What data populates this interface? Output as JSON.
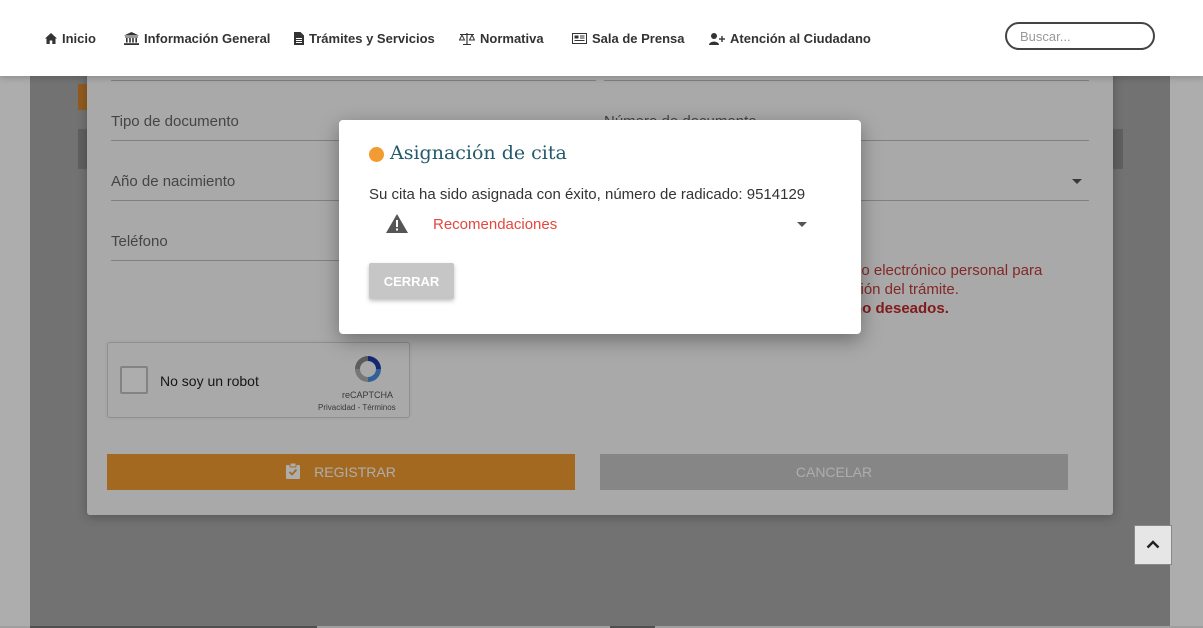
{
  "nav": {
    "items": [
      {
        "label": "Inicio",
        "icon": "home-icon"
      },
      {
        "label": "Información General",
        "icon": "bank-icon"
      },
      {
        "label": "Trámites y Servicios",
        "icon": "document-icon"
      },
      {
        "label": "Normativa",
        "icon": "scale-icon"
      },
      {
        "label": "Sala de Prensa",
        "icon": "newspaper-icon"
      },
      {
        "label": "Atención al Ciudadano",
        "icon": "user-plus-icon"
      }
    ],
    "search_placeholder": "Buscar..."
  },
  "form": {
    "fields": {
      "tipo_documento": "Tipo de documento",
      "numero_documento": "Número de documento",
      "anio_nacimiento": "Año de nacimiento",
      "telefono": "Teléfono"
    },
    "notice": {
      "line1": "eo electrónico personal para",
      "line2": "ción del trámite.",
      "line3": "no deseados."
    },
    "recaptcha": {
      "label": "No soy un robot",
      "brand": "reCAPTCHA",
      "links": "Privacidad - Términos"
    },
    "register_label": "REGISTRAR",
    "cancel_label": "CANCELAR"
  },
  "modal": {
    "title": "Asignación de cita",
    "message": "Su cita ha sido asignada con éxito, número de radicado: 9514129",
    "recommendations_label": "Recomendaciones",
    "close_label": "CERRAR"
  },
  "colors": {
    "accent_orange": "#f29b32",
    "title_teal": "#245a6b",
    "warning_red": "#e4473d",
    "button_gray": "#c6c6c6"
  }
}
